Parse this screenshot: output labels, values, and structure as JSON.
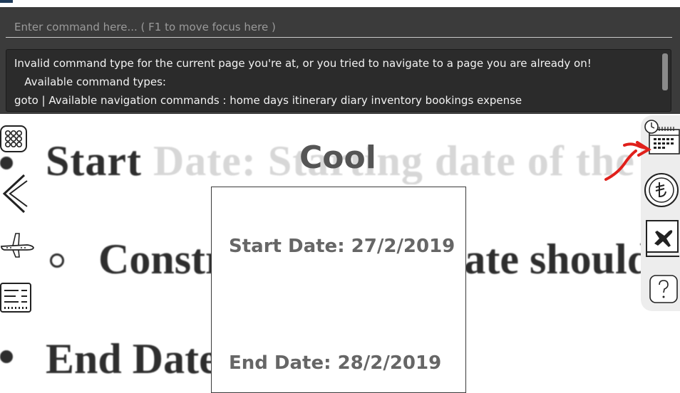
{
  "command_box": {
    "placeholder": "Enter command here... ( F1 to move focus here )",
    "value": ""
  },
  "result_display": {
    "lines": [
      "Invalid command type for the current page you're at, or you tried to navigate to a page you are already on!",
      "   Available command types:",
      "goto | Available navigation commands : home days itinerary diary inventory bookings expense"
    ]
  },
  "background_doc": {
    "line1_bold": "Start",
    "line1_faint": " Date: Starting date of the trip",
    "line2": "Constraints: Start date should be",
    "line3": "End Date"
  },
  "trip_card": {
    "title": "Cool",
    "start_date": "Start Date: 27/2/2019",
    "end_date": "End Date: 28/2/2019"
  },
  "left_nav": [
    {
      "icon": "grid-icon"
    },
    {
      "icon": "chevron-left-icon"
    },
    {
      "icon": "airplane-icon"
    },
    {
      "icon": "list-icon"
    }
  ],
  "right_nav": [
    {
      "icon": "calendar-clock-icon"
    },
    {
      "icon": "currency-coin-icon"
    },
    {
      "icon": "plane-book-icon"
    },
    {
      "icon": "help-icon"
    }
  ],
  "colors": {
    "panel_bg": "#3b3b3b",
    "result_bg": "#2b2b2b",
    "annotation_red": "#e0201b"
  }
}
